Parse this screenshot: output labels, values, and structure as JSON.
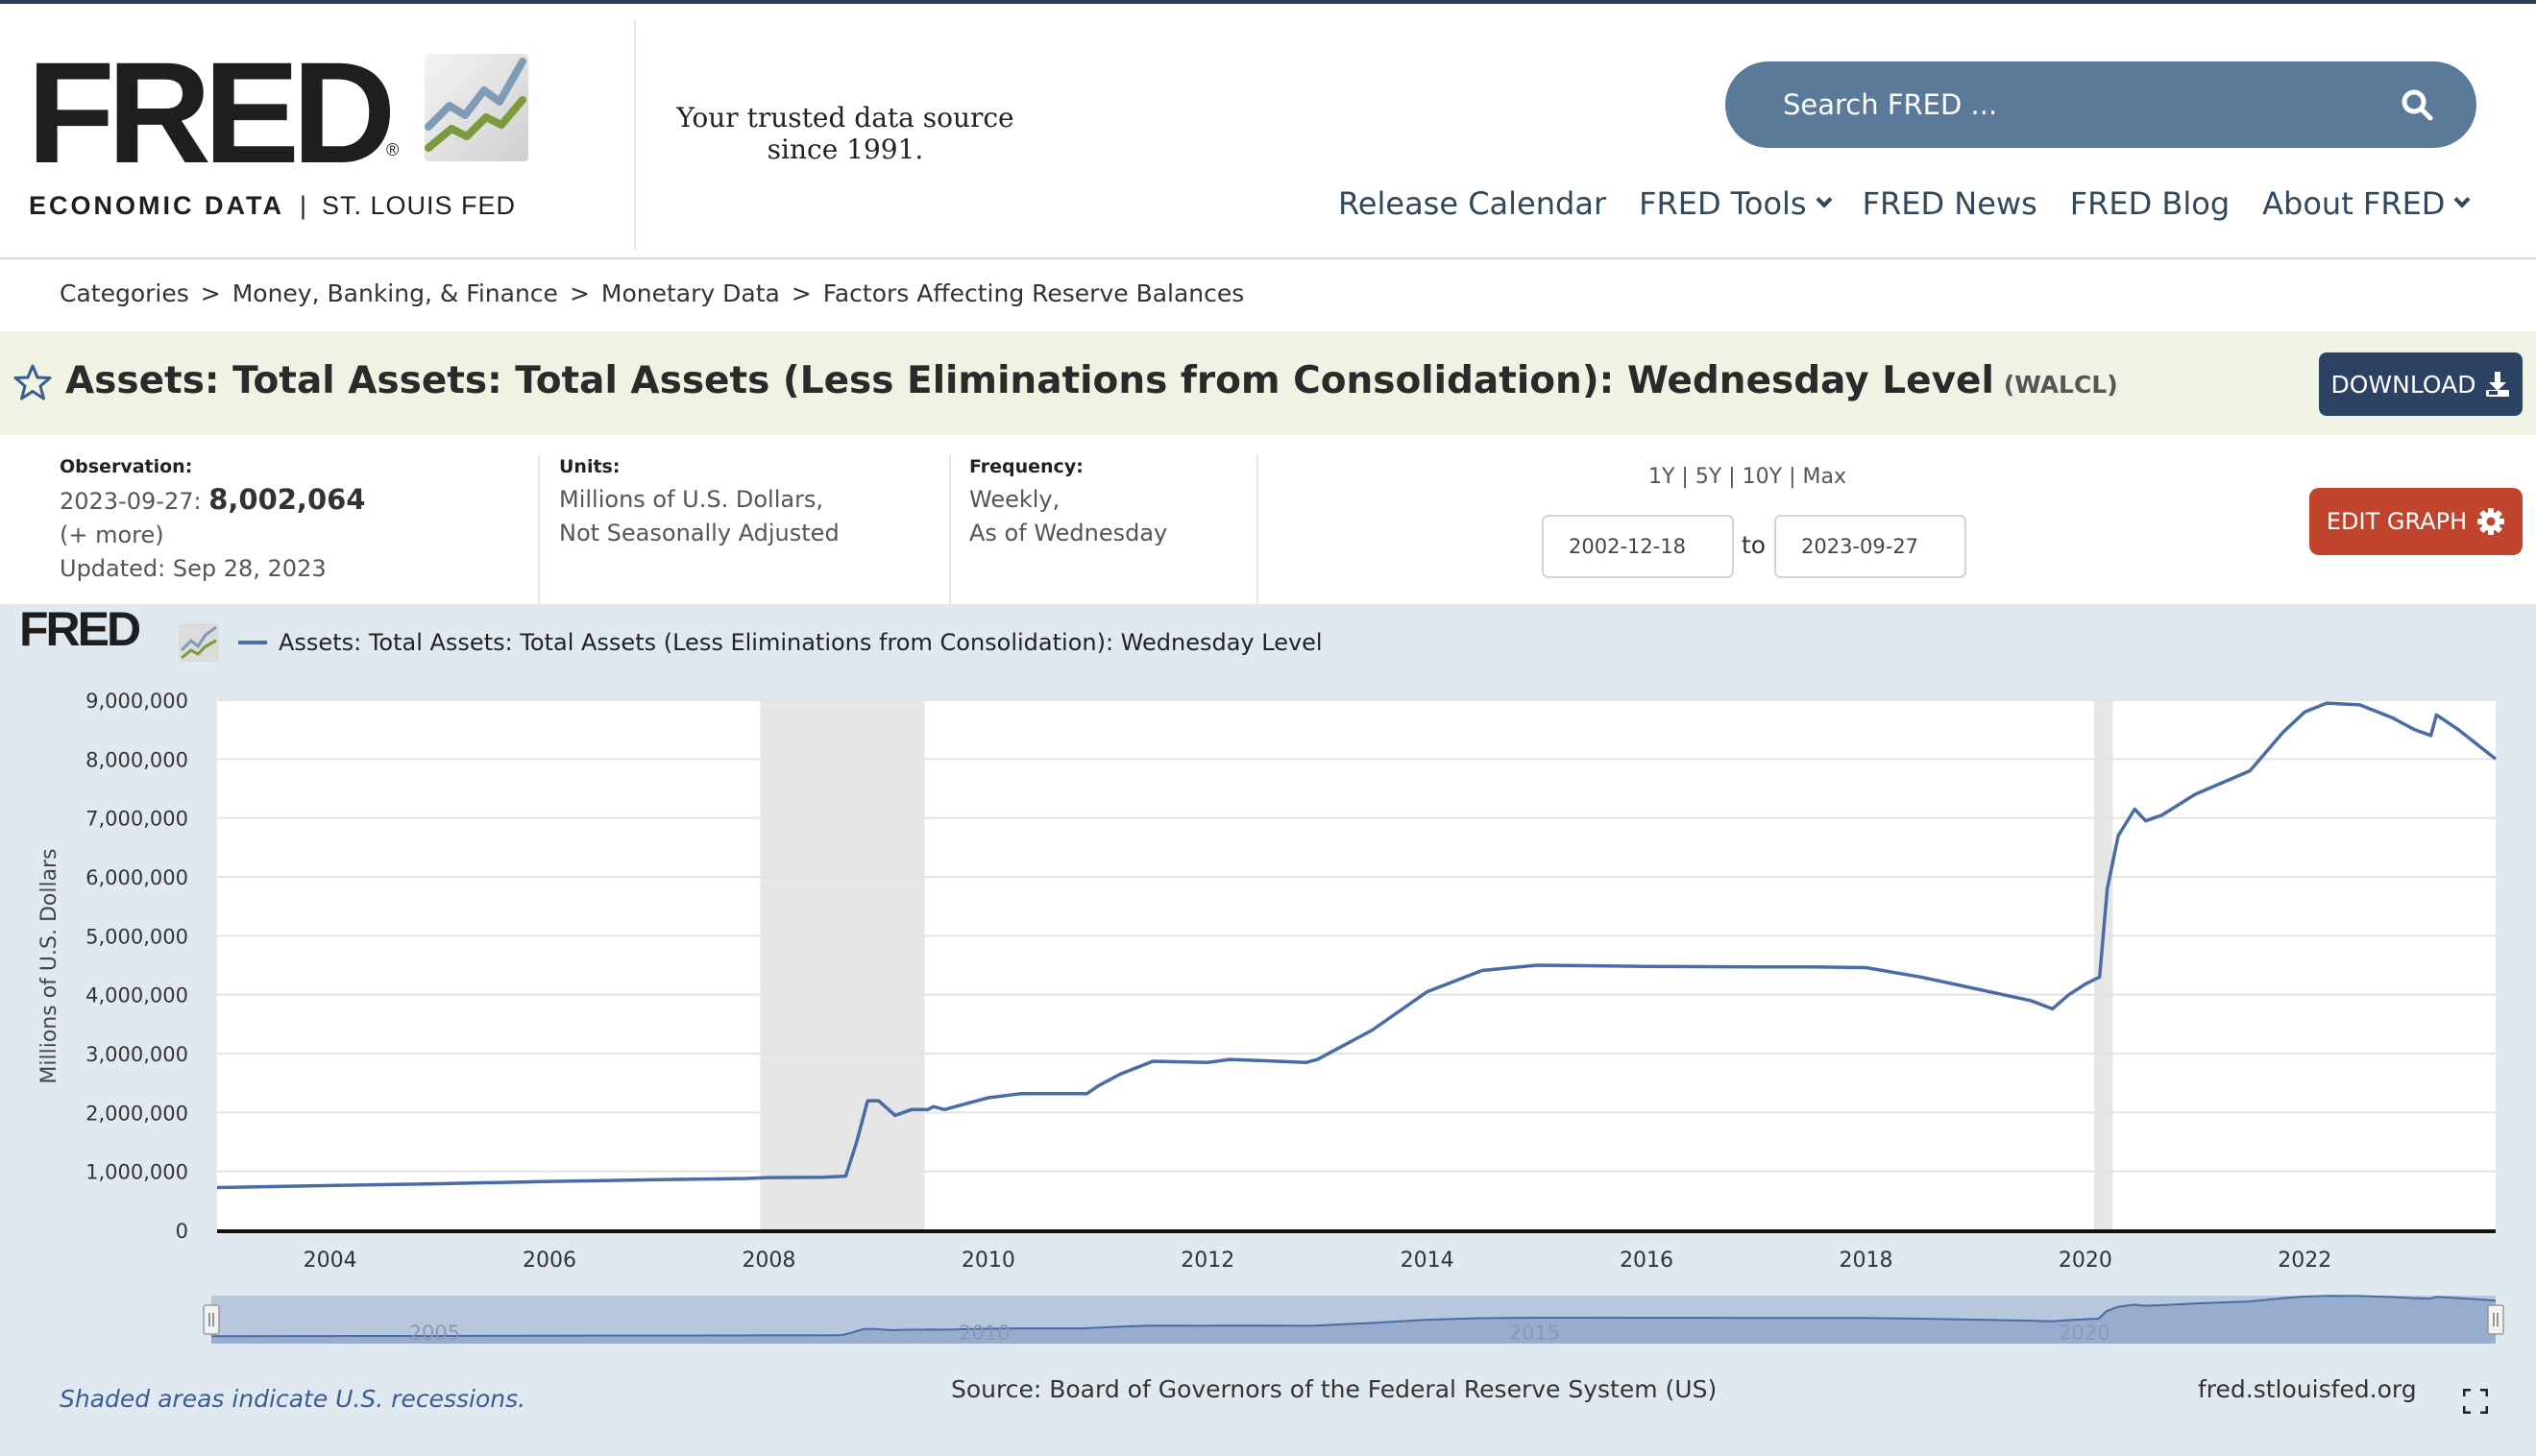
{
  "header": {
    "logo_text": "FRED",
    "logo_reg": "®",
    "logo_sub_left": "ECONOMIC DATA",
    "logo_sub_sep": "|",
    "logo_sub_right": "ST. LOUIS FED",
    "tagline": "Your trusted data source since 1991.",
    "search_placeholder": "Search FRED ...",
    "nav": [
      "Release Calendar",
      "FRED Tools",
      "FRED News",
      "FRED Blog",
      "About FRED"
    ]
  },
  "breadcrumb": [
    "Categories",
    ">",
    "Money, Banking, & Finance",
    ">",
    "Monetary Data",
    ">",
    "Factors Affecting Reserve Balances"
  ],
  "series": {
    "title": "Assets: Total Assets: Total Assets (Less Eliminations from Consolidation): Wednesday Level",
    "id": "(WALCL)",
    "download_label": "DOWNLOAD"
  },
  "meta": {
    "observation_label": "Observation:",
    "observation_date": "2023-09-27:",
    "observation_value": "8,002,064",
    "more": "(+ more)",
    "updated": "Updated: Sep 28, 2023",
    "units_label": "Units:",
    "units_line1": "Millions of U.S. Dollars,",
    "units_line2": "Not Seasonally Adjusted",
    "frequency_label": "Frequency:",
    "frequency_line1": "Weekly,",
    "frequency_line2": "As of Wednesday",
    "range_links": "1Y | 5Y | 10Y | Max",
    "date_from": "2002-12-18",
    "date_to_word": "to",
    "date_to": "2023-09-27",
    "edit_graph_label": "EDIT GRAPH"
  },
  "footer": {
    "shaded_note": "Shaded areas indicate U.S. recessions.",
    "source": "Source: Board of Governors of the Federal Reserve System (US)",
    "site": "fred.stlouisfed.org"
  },
  "colors": {
    "line": "#4a6ca5",
    "recession": "#e6e6e6",
    "accent_dark": "#2c4263",
    "accent_red": "#c0452c"
  },
  "chart_data": {
    "type": "line",
    "logo": "FRED",
    "legend": [
      "Assets: Total Assets: Total Assets (Less Eliminations from Consolidation): Wednesday Level"
    ],
    "legend_placement": "top-left",
    "ylabel": "Millions of U.S. Dollars",
    "xlabel": "",
    "ylim": [
      0,
      9000000
    ],
    "xlim": [
      2002.97,
      2023.74
    ],
    "grid": true,
    "y_ticks": [
      "0",
      "1,000,000",
      "2,000,000",
      "3,000,000",
      "4,000,000",
      "5,000,000",
      "6,000,000",
      "7,000,000",
      "8,000,000",
      "9,000,000"
    ],
    "y_tick_values": [
      0,
      1000000,
      2000000,
      3000000,
      4000000,
      5000000,
      6000000,
      7000000,
      8000000,
      9000000
    ],
    "x_ticks": [
      "2004",
      "2006",
      "2008",
      "2010",
      "2012",
      "2014",
      "2016",
      "2018",
      "2020",
      "2022"
    ],
    "x_tick_values": [
      2004,
      2006,
      2008,
      2010,
      2012,
      2014,
      2016,
      2018,
      2020,
      2022
    ],
    "recessions": [
      [
        2007.92,
        2009.42
      ],
      [
        2020.08,
        2020.25
      ]
    ],
    "navigator_labels": [
      "2005",
      "2010",
      "2015",
      "2020"
    ],
    "navigator_label_values": [
      2005,
      2010,
      2015,
      2020
    ],
    "series": [
      {
        "name": "Assets: Total Assets: Total Assets (Less Eliminations from Consolidation): Wednesday Level",
        "x": [
          2002.97,
          2004.0,
          2005.0,
          2006.0,
          2007.0,
          2007.8,
          2008.0,
          2008.5,
          2008.7,
          2008.8,
          2008.9,
          2009.0,
          2009.15,
          2009.3,
          2009.45,
          2009.5,
          2009.6,
          2009.8,
          2010.0,
          2010.3,
          2010.7,
          2010.9,
          2011.0,
          2011.2,
          2011.5,
          2012.0,
          2012.2,
          2012.5,
          2012.9,
          2013.0,
          2013.5,
          2014.0,
          2014.5,
          2015.0,
          2016.0,
          2017.0,
          2017.5,
          2018.0,
          2018.5,
          2019.0,
          2019.5,
          2019.7,
          2019.85,
          2020.0,
          2020.13,
          2020.2,
          2020.3,
          2020.45,
          2020.55,
          2020.7,
          2021.0,
          2021.5,
          2021.8,
          2022.0,
          2022.2,
          2022.5,
          2022.8,
          2023.0,
          2023.15,
          2023.2,
          2023.4,
          2023.74
        ],
        "y": [
          725000,
          760000,
          790000,
          830000,
          860000,
          880000,
          895000,
          900000,
          920000,
          1500000,
          2200000,
          2200000,
          1950000,
          2050000,
          2050000,
          2100000,
          2050000,
          2150000,
          2250000,
          2320000,
          2320000,
          2320000,
          2450000,
          2650000,
          2870000,
          2850000,
          2900000,
          2880000,
          2850000,
          2900000,
          3400000,
          4050000,
          4410000,
          4500000,
          4480000,
          4470000,
          4470000,
          4460000,
          4300000,
          4100000,
          3900000,
          3760000,
          4000000,
          4180000,
          4300000,
          5800000,
          6700000,
          7150000,
          6950000,
          7050000,
          7400000,
          7800000,
          8450000,
          8800000,
          8950000,
          8920000,
          8700000,
          8500000,
          8400000,
          8750000,
          8500000,
          8002064
        ]
      }
    ]
  }
}
